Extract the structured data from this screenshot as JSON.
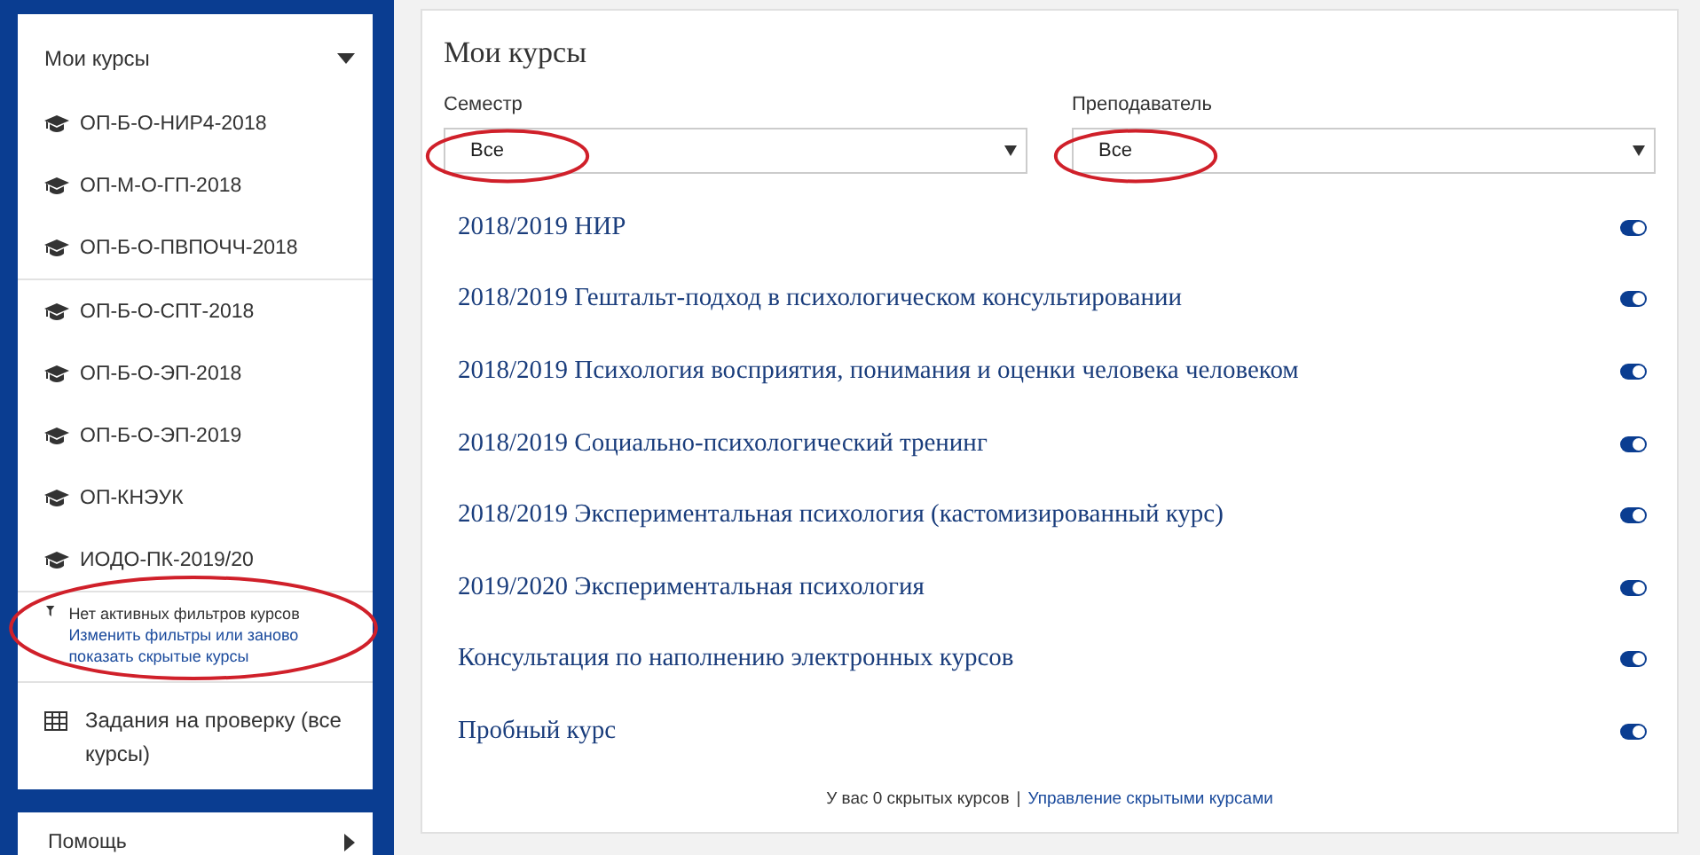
{
  "sidebar": {
    "header": {
      "label": "Мои курсы",
      "expanded": true
    },
    "course_groups": [
      [
        "ОП-Б-О-НИР4-2018",
        "ОП-М-О-ГП-2018",
        "ОП-Б-О-ПВПОЧЧ-2018"
      ],
      [
        "ОП-Б-О-СПТ-2018",
        "ОП-Б-О-ЭП-2018",
        "ОП-Б-О-ЭП-2019",
        "ОП-КНЭУК",
        "ИОДО-ПК-2019/20"
      ]
    ],
    "filter_notice": {
      "text": "Нет активных фильтров курсов",
      "link": "Изменить фильтры или заново показать скрытые курсы",
      "highlighted": true
    },
    "assignments_link": "Задания на проверку (все курсы)",
    "help": {
      "label": "Помощь",
      "expanded": false
    }
  },
  "main": {
    "title": "Мои курсы",
    "filters": [
      {
        "label": "Семестр",
        "value": "Все",
        "highlighted": true
      },
      {
        "label": "Преподаватель",
        "value": "Все",
        "highlighted": true
      }
    ],
    "courses": [
      {
        "title": "2018/2019 НИР",
        "on": true
      },
      {
        "title": "2018/2019 Гештальт-подход в психологическом консультировании",
        "on": true
      },
      {
        "title": "2018/2019 Психология восприятия, понимания и оценки человека человеком",
        "on": true
      },
      {
        "title": "2018/2019 Социально-психологический тренинг",
        "on": true
      },
      {
        "title": "2018/2019 Экспериментальная психология (кастомизированный курс)",
        "on": true
      },
      {
        "title": "2019/2020 Экспериментальная психология",
        "on": true
      },
      {
        "title": "Консультация по наполнению электронных курсов",
        "on": true
      },
      {
        "title": "Пробный курс",
        "on": true
      }
    ],
    "footer": {
      "text": "У вас 0 скрытых курсов",
      "separator": "|",
      "link": "Управление скрытыми курсами"
    }
  }
}
